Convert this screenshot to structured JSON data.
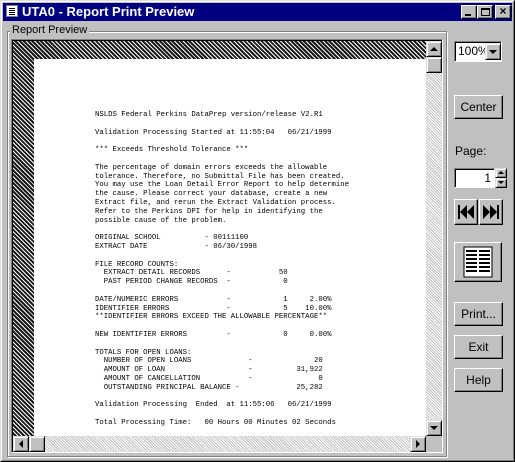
{
  "window": {
    "title": "UTA0 - Report Print Preview",
    "caption_buttons": [
      "minimize",
      "maximize",
      "close"
    ],
    "close_glyph": "×"
  },
  "preview": {
    "group_label": "Report Preview",
    "report_lines": [
      "NSLDS Federal Perkins DataPrep version/release V2.R1",
      "",
      "Validation Processing Started at 11:55:04   06/21/1999",
      "",
      "*** Exceeds Threshold Tolerance ***",
      "",
      "The percentage of domain errors exceeds the allowable",
      "tolerance. Therefore, no Submittal File has been created.",
      "You may use the Loan Detail Error Report to help determine",
      "the cause. Please correct your database, create a new",
      "Extract file, and rerun the Extract Validation process.",
      "Refer to the Perkins DPI for help in identifying the",
      "possible cause of the problem.",
      "",
      "ORIGINAL SCHOOL          - 00111100",
      "EXTRACT DATE             - 06/30/1998",
      "",
      "FILE RECORD COUNTS:",
      "  EXTRACT DETAIL RECORDS      -           50",
      "  PAST PERIOD CHANGE RECORDS  -            0",
      "",
      "DATE/NUMERIC ERRORS           -            1     2.00%",
      "IDENTIFIER ERRORS             -            5    10.00%",
      "**IDENTIFIER ERRORS EXCEED THE ALLOWABLE PERCENTAGE**",
      "",
      "NEW IDENTIFIER ERRORS         -            0     0.00%",
      "",
      "TOTALS FOR OPEN LOANS:",
      "  NUMBER OF OPEN LOANS             -              20",
      "  AMOUNT OF LOAN                   -          31,922",
      "  AMOUNT OF CANCELLATION           -               0",
      "  OUTSTANDING PRINCIPAL BALANCE -             25,282",
      "",
      "Validation Processing  Ended  at 11:55:06   06/21/1999",
      "",
      "Total Processing Time:   00 Hours 00 Minutes 02 Seconds"
    ]
  },
  "controls": {
    "zoom_value": "100%",
    "center_label": "Center",
    "page_label": "Page:",
    "page_value": "1",
    "print_label": "Print...",
    "exit_label": "Exit",
    "help_label": "Help",
    "icons": [
      "first-page-icon",
      "last-page-icon",
      "multi-page-view-icon"
    ]
  }
}
